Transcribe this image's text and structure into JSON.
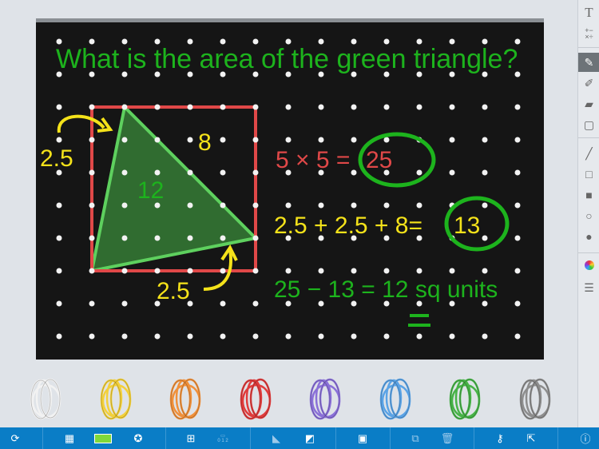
{
  "board": {
    "question": "What is the area of the green triangle?",
    "label_left": "2.5",
    "label_top": "8",
    "label_inside": "12",
    "label_bottom": "2.5",
    "eq1_lhs": "5 × 5 =",
    "eq1_rhs": "25",
    "eq2_lhs": "2.5 + 2.5 + 8=",
    "eq2_rhs": "13",
    "eq3": "25 − 13 = 12 sq units",
    "colors": {
      "green": "#1db31d",
      "yellow": "#f4e21a",
      "red": "#e04848",
      "board": "#111"
    }
  },
  "right_toolbar": [
    "text-tool",
    "math-symbols",
    "pen",
    "marker",
    "highlighter",
    "note",
    "line",
    "rectangle",
    "filled-rectangle",
    "circle",
    "filled-circle",
    "color-picker",
    "menu"
  ],
  "right_toolbar_labels": {
    "text": "T",
    "math": "+−\n×÷"
  },
  "bands": [
    "white",
    "yellow",
    "orange",
    "red",
    "purple",
    "blue",
    "green",
    "gray"
  ],
  "band_colors": [
    "#f2f2f2",
    "#f3d03a",
    "#f0903a",
    "#e03c3c",
    "#8a70d8",
    "#5aa3e6",
    "#47b347",
    "#8d8d8d"
  ],
  "bottom_toolbar": {
    "number_label": "0 1 2"
  }
}
